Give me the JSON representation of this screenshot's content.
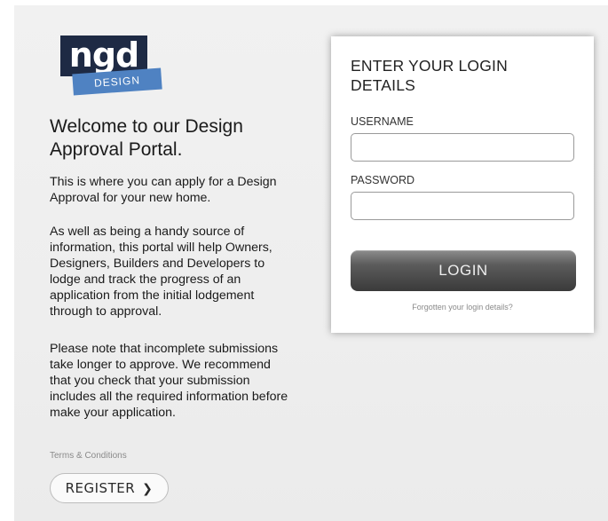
{
  "logo": {
    "top_text": "ngd",
    "bottom_text": "DESIGN"
  },
  "intro": {
    "heading": "Welcome to our Design Approval Portal.",
    "paragraph1": "This is where you can apply for a Design Approval for your new home.",
    "paragraph2": "As well as being a handy source of information, this portal will help Owners, Designers, Builders and Developers to lodge and track the progress of an application from the initial lodgement through to approval.",
    "paragraph3": "Please note that incomplete submissions take longer to approve. We recommend that you check that your submission includes all the required information before make your application."
  },
  "terms_link": "Terms & Conditions",
  "register_button": {
    "label": "REGISTER",
    "icon": "chevron-right-icon"
  },
  "login": {
    "title": "ENTER YOUR LOGIN DETAILS",
    "username_label": "USERNAME",
    "username_value": "",
    "password_label": "PASSWORD",
    "password_value": "",
    "button_label": "LOGIN",
    "forgot_link": "Forgotten your login details?"
  },
  "colors": {
    "logo_dark": "#1e2a44",
    "logo_blue": "#4f82c2",
    "login_button": "#4a4a4a",
    "background": "#eeeeee"
  }
}
